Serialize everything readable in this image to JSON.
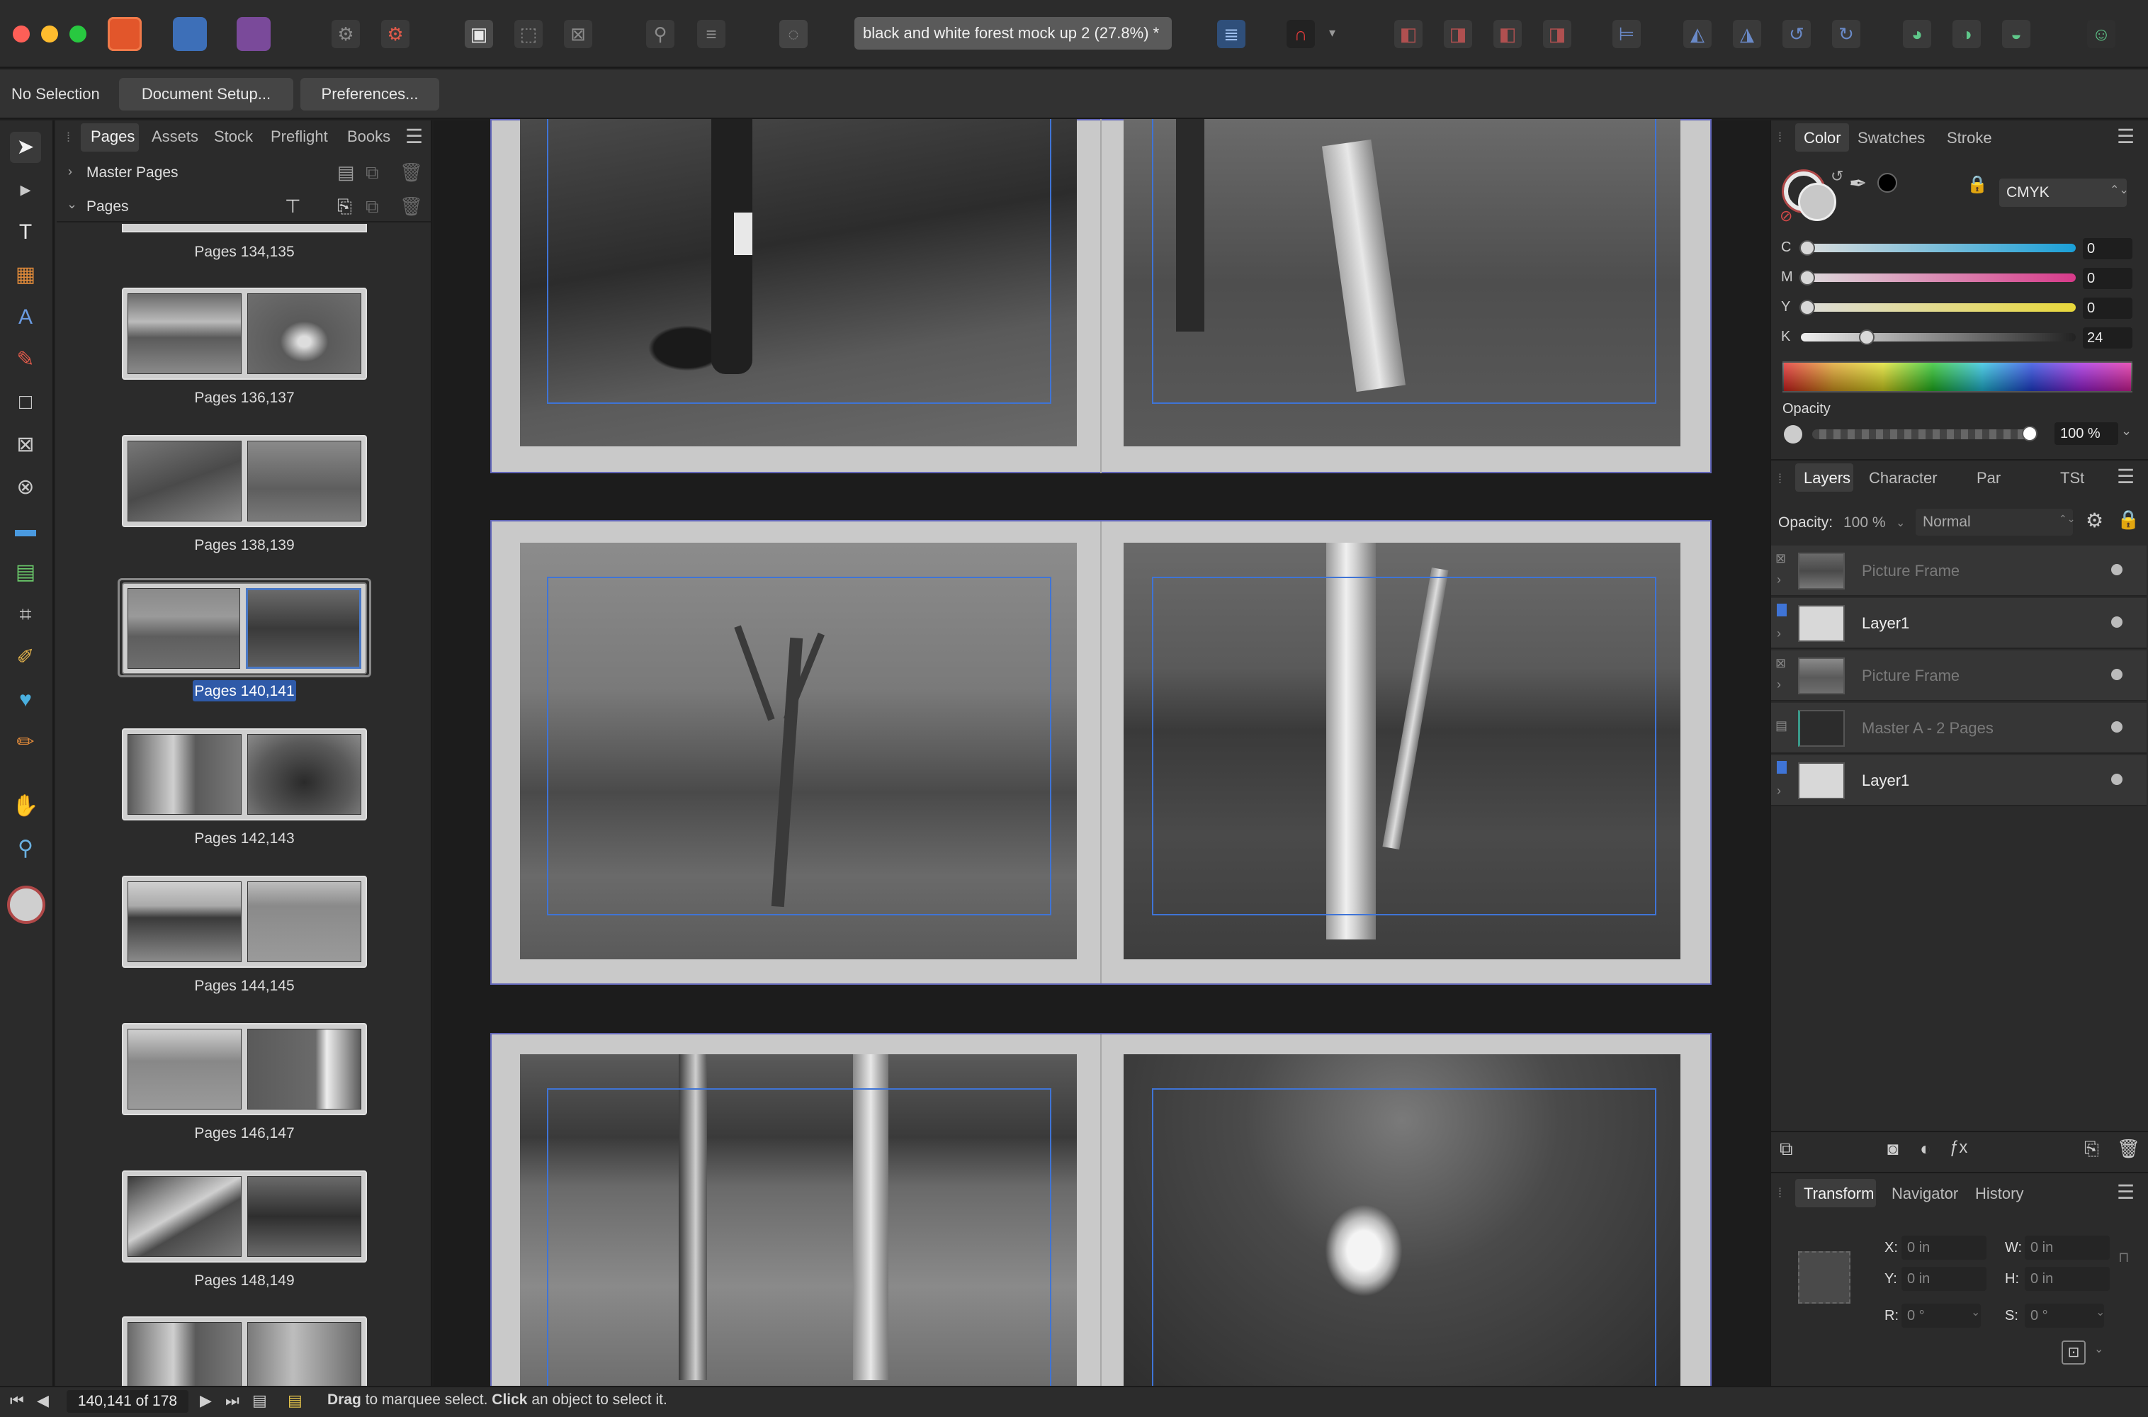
{
  "window": {
    "document_title": "black and white forest mock up 2  (27.8%) *"
  },
  "context_bar": {
    "selection_label": "No Selection",
    "document_setup_label": "Document Setup...",
    "preferences_label": "Preferences..."
  },
  "pages_panel": {
    "tabs": [
      "Pages",
      "Assets",
      "Stock",
      "Preflight",
      "Books"
    ],
    "master_pages_label": "Master Pages",
    "pages_section_label": "Pages",
    "spreads": [
      {
        "label": "Pages 134,135"
      },
      {
        "label": "Pages 136,137"
      },
      {
        "label": "Pages 138,139"
      },
      {
        "label": "Pages 140,141",
        "selected": true
      },
      {
        "label": "Pages 142,143"
      },
      {
        "label": "Pages 144,145"
      },
      {
        "label": "Pages 146,147"
      },
      {
        "label": "Pages 148,149"
      }
    ]
  },
  "color_panel": {
    "tabs": [
      "Color",
      "Swatches",
      "Stroke"
    ],
    "model": "CMYK",
    "channels": [
      {
        "name": "C",
        "value": "0"
      },
      {
        "name": "M",
        "value": "0"
      },
      {
        "name": "Y",
        "value": "0"
      },
      {
        "name": "K",
        "value": "24"
      }
    ],
    "opacity_label": "Opacity",
    "opacity_value": "100 %"
  },
  "layers_panel": {
    "tabs": [
      "Layers",
      "Character",
      "Par",
      "TSt"
    ],
    "opacity_label": "Opacity:",
    "opacity_value": "100 %",
    "blend_mode": "Normal",
    "layers": [
      {
        "name": "Picture Frame",
        "dimmed": true
      },
      {
        "name": "Layer1",
        "dimmed": false
      },
      {
        "name": "Picture Frame",
        "dimmed": true
      },
      {
        "name": "Master A - 2 Pages",
        "dimmed": true
      },
      {
        "name": "Layer1",
        "dimmed": false
      }
    ]
  },
  "transform_panel": {
    "tabs": [
      "Transform",
      "Navigator",
      "History"
    ],
    "x_label": "X:",
    "x_value": "0 in",
    "y_label": "Y:",
    "y_value": "0 in",
    "w_label": "W:",
    "w_value": "0 in",
    "h_label": "H:",
    "h_value": "0 in",
    "r_label": "R:",
    "r_value": "0 °",
    "s_label": "S:",
    "s_value": "0 °"
  },
  "status_bar": {
    "page_indicator": "140,141 of 178",
    "hint_bold_1": "Drag",
    "hint_text_1": " to marquee select. ",
    "hint_bold_2": "Click",
    "hint_text_2": " an object to select it."
  },
  "colors": {
    "accent": "#3f74d6",
    "spread_border": "#6266b8",
    "selected_thumb": "#4a78c4"
  }
}
